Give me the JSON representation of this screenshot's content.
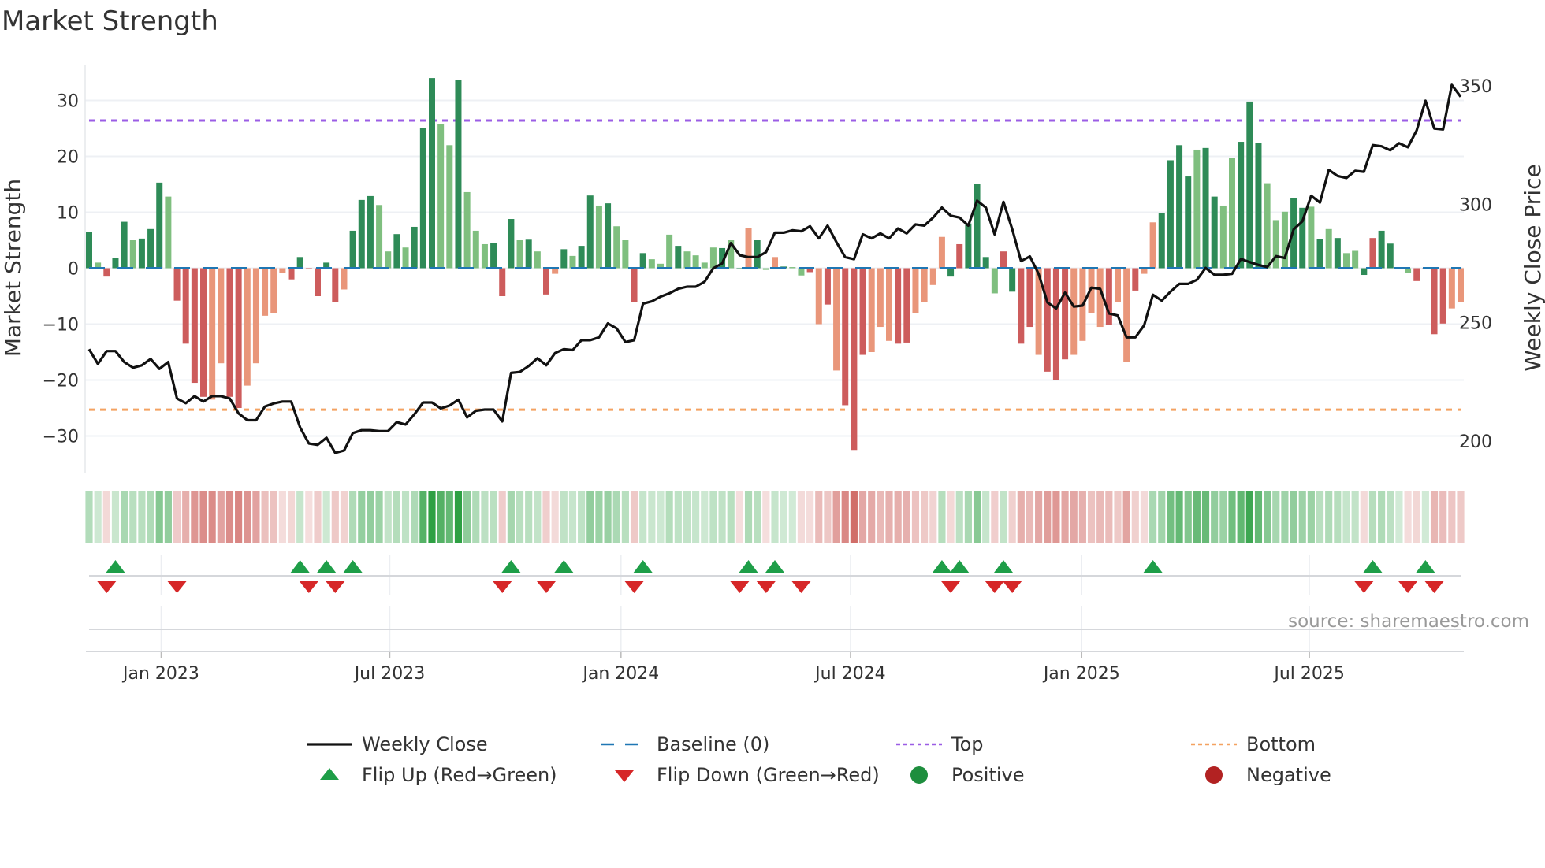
{
  "title": "Market Strength",
  "source": "source: sharemaestro.com",
  "colors": {
    "strong_positive": "#2e8b57",
    "weak_positive": "#7fbf7f",
    "strong_negative": "#cd5c5c",
    "weak_negative": "#e9967a",
    "baseline": "#1f77b4",
    "top": "#9b5de5",
    "bottom": "#f4a261",
    "close": "#111111",
    "flip_up": "#1e9e48",
    "flip_down": "#d62728",
    "positive": "#1e8e3e",
    "negative": "#b22222"
  },
  "chart_data": {
    "type": "bar",
    "title": "Market Strength",
    "ylabel": "Market Strength",
    "y2label": "Weekly Close Price",
    "ylim": [
      -36,
      36
    ],
    "y2lim": [
      200,
      350
    ],
    "yticks": [
      "30",
      "20",
      "10",
      "0",
      "−10",
      "−20",
      "−30"
    ],
    "ytick_values": [
      30,
      20,
      10,
      0,
      -10,
      -20,
      -30
    ],
    "y2ticks": [
      "350",
      "300",
      "250",
      "200"
    ],
    "y2tick_values": [
      350,
      300,
      250,
      200
    ],
    "top_level": 26.4,
    "bottom_level": -25.3,
    "baseline": 0,
    "x_unit": "week index",
    "xticks": [
      {
        "label": "Jan 2023",
        "week": 8.2
      },
      {
        "label": "Jul 2023",
        "week": 34.2
      },
      {
        "label": "Jan 2024",
        "week": 60.5
      },
      {
        "label": "Jul 2024",
        "week": 86.6
      },
      {
        "label": "Jan 2025",
        "week": 112.9
      },
      {
        "label": "Jul 2025",
        "week": 138.8
      }
    ],
    "strength": [
      6.5,
      1,
      -1.5,
      1.8,
      8.3,
      5,
      5.3,
      7,
      15.3,
      12.8,
      -5.8,
      -13.5,
      -20.5,
      -23,
      -23.5,
      -17,
      -23,
      -25,
      -21,
      -17,
      -8.5,
      -8,
      -0.8,
      -2,
      2,
      -0.2,
      -5,
      1,
      -6,
      -3.8,
      6.7,
      12.2,
      12.9,
      11.3,
      3,
      6.1,
      3.7,
      7.4,
      25,
      34,
      25.8,
      22,
      33.7,
      13.6,
      6.7,
      4.3,
      4.5,
      -5,
      8.8,
      5,
      5.1,
      3,
      -4.7,
      -1,
      3.4,
      2.2,
      4,
      13,
      11.2,
      11.6,
      7.5,
      5,
      -6,
      2.7,
      1.6,
      0.8,
      6,
      4,
      3,
      2.3,
      1,
      3.7,
      3.6,
      5,
      -0.2,
      7.2,
      5,
      -0.3,
      2,
      0.3,
      0.2,
      -1.3,
      -0.7,
      -10,
      -6.5,
      -18.3,
      -24.5,
      -32.5,
      -15.5,
      -15,
      -10.5,
      -13,
      -13.5,
      -13.3,
      -8,
      -6,
      -3,
      5.6,
      -1.5,
      4.3,
      8,
      15,
      2,
      -4.5,
      3,
      -4.2,
      -13.5,
      -10.5,
      -15.5,
      -18.5,
      -20,
      -16.3,
      -15.5,
      -13,
      -8,
      -10.5,
      -10.2,
      -6,
      -16.8,
      -4,
      -1,
      8.2,
      9.8,
      19.3,
      22,
      16.4,
      21.2,
      21.5,
      12.8,
      11.2,
      19.7,
      22.6,
      29.8,
      22.4,
      15.2,
      8.6,
      10.1,
      12.6,
      10.8,
      11,
      5.2,
      7,
      5.4,
      2.7,
      3.1,
      -1.2,
      5.4,
      6.7,
      4.4,
      0,
      -0.8,
      -2.3,
      0,
      -11.8,
      -9.9,
      -7.2,
      -6.1
    ],
    "strength_type": "GgRGGgGGGgRRRRrrRRrrrrrRGRRGRrGGGggGgGGGggGgggGRGgGgRrGgGGgGggRGgggGggggGgGrGgrGggRrRrRRRrrrRRrrrrGRGGGgRGRRrRRRrrrrRrrRrrGGGGgGGggGGGgggGGgGgGggGRGGggRRRRrrr",
    "weekly_close": [
      238.8,
      232.6,
      238,
      238,
      233.4,
      231,
      232,
      234.7,
      230.5,
      233.4,
      218,
      216,
      219,
      216.7,
      219,
      219,
      218,
      211.7,
      208.8,
      208.8,
      214.6,
      215.9,
      216.7,
      216.7,
      205.8,
      199,
      198.4,
      201.4,
      195,
      196,
      203.4,
      204.6,
      204.6,
      204.2,
      204.2,
      208,
      207,
      211.3,
      216.3,
      216.3,
      213.8,
      215,
      217.5,
      210,
      212.8,
      213.3,
      213.3,
      208.3,
      228.8,
      229.2,
      231.7,
      235,
      232,
      237.2,
      238.8,
      238.4,
      242.6,
      242.6,
      243.8,
      249.7,
      247.6,
      241.8,
      242.6,
      258,
      259,
      261,
      262.4,
      264.3,
      265.2,
      265.2,
      267.3,
      273,
      275,
      283.6,
      278.5,
      277.7,
      277.7,
      279.8,
      288,
      288,
      289,
      288.6,
      290.7,
      285.6,
      291,
      284,
      277.7,
      276.8,
      287.3,
      285.6,
      287.7,
      285.6,
      289.8,
      287.7,
      291.5,
      291,
      294.4,
      298.6,
      295.2,
      294.4,
      291,
      301.5,
      298.6,
      287.3,
      301,
      289.4,
      276,
      278,
      270.6,
      258.5,
      256,
      262.7,
      256.8,
      257.2,
      264.8,
      264.3,
      253.9,
      253,
      243.8,
      243.8,
      248.9,
      261.8,
      259.3,
      263.1,
      266.4,
      266.4,
      268.1,
      273.1,
      270.2,
      270.2,
      270.6,
      276.9,
      275.6,
      274.4,
      273.5,
      278.1,
      277.3,
      289.4,
      292.8,
      303.6,
      300.7,
      314.5,
      312,
      311.1,
      314.1,
      313.7,
      325,
      324.5,
      322.8,
      325.8,
      324.1,
      331.2,
      343.7,
      332,
      331.6,
      350.4,
      345.4
    ],
    "flip_up_weeks": [
      3,
      24,
      27,
      30,
      48,
      54,
      63,
      75,
      78,
      97,
      99,
      104,
      121,
      146,
      152
    ],
    "flip_down_weeks": [
      2,
      10,
      25,
      28,
      47,
      52,
      62,
      74,
      77,
      81,
      98,
      103,
      105,
      145,
      150,
      153
    ],
    "legend_position": "bottom",
    "legend": [
      {
        "label": "Weekly Close",
        "symbol": "line"
      },
      {
        "label": "Baseline (0)",
        "symbol": "dashed"
      },
      {
        "label": "Top",
        "symbol": "dotted-top"
      },
      {
        "label": "Bottom",
        "symbol": "dotted-bottom"
      },
      {
        "label": "Flip Up (Red→Green)",
        "symbol": "triangle-up"
      },
      {
        "label": "Flip Down (Green→Red)",
        "symbol": "triangle-down"
      },
      {
        "label": "Positive",
        "symbol": "circle-positive"
      },
      {
        "label": "Negative",
        "symbol": "circle-negative"
      }
    ]
  }
}
